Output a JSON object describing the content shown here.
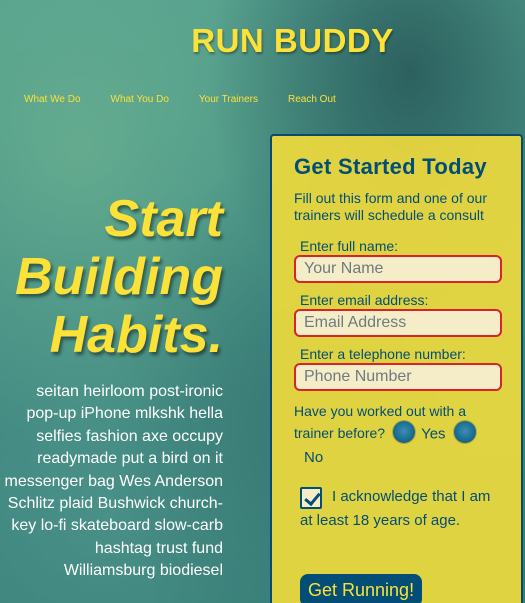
{
  "header": {
    "brand": "RUN BUDDY",
    "nav": [
      "What We Do",
      "What You Do",
      "Your Trainers",
      "Reach Out"
    ]
  },
  "hero": {
    "title_lines": [
      "Start",
      "Building",
      "Habits."
    ],
    "text": "seitan heirloom post-ironic pop-up iPhone mlkshk hella selfies fashion axe occupy readymade put a bird on it messenger bag Wes Anderson Schlitz plaid Bushwick church-key lo-fi skateboard slow-carb hashtag trust fund Williamsburg biodiesel"
  },
  "form": {
    "title": "Get Started Today",
    "description": "Fill out this form and one of our trainers will schedule a consult",
    "fields": [
      {
        "label": "Enter full name:",
        "placeholder": "Your Name"
      },
      {
        "label": "Enter email address:",
        "placeholder": "Email Address"
      },
      {
        "label": "Enter a telephone number:",
        "placeholder": "Phone Number"
      }
    ],
    "question": "Have you worked out with a trainer before?",
    "radio_yes": "Yes",
    "radio_no": "No",
    "acknowledge_line1": "I acknowledge that I am",
    "acknowledge_line2": "at least 18 years of age.",
    "acknowledge_checked": true,
    "submit": "Get Running!"
  },
  "colors": {
    "accent_yellow": "#fce138",
    "navy": "#024e76",
    "input_border": "#d8232a"
  }
}
